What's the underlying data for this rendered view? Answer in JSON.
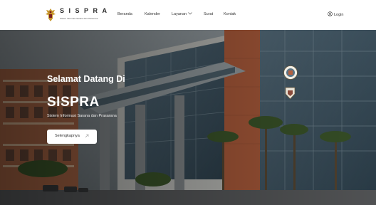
{
  "brand": {
    "title": "SISPRA",
    "subtitle": "Sistem Informasi Sarana dan Prasarana"
  },
  "nav": {
    "items": [
      {
        "label": "Beranda"
      },
      {
        "label": "Kalender"
      },
      {
        "label": "Layanan"
      },
      {
        "label": "Surat"
      },
      {
        "label": "Kontak"
      }
    ],
    "login_label": "Login"
  },
  "hero": {
    "welcome": "Selamat Datang Di",
    "title": "SISPRA",
    "subtitle": "Sistem Informasi Sarana dan Prasarana",
    "cta_label": "Selengkapnya"
  },
  "icons": {
    "emblem": "garuda-emblem-icon",
    "chevron": "chevron-down-icon",
    "user": "user-circle-icon",
    "arrow": "arrow-up-right-icon",
    "badge_a": "campus-logo-badge-icon",
    "badge_b": "shield-logo-badge-icon"
  },
  "colors": {
    "header_bg": "#ffffff",
    "nav_text": "#333333",
    "hero_text": "#ffffff",
    "brick": "#b5603e",
    "glass": "#3f5665"
  }
}
